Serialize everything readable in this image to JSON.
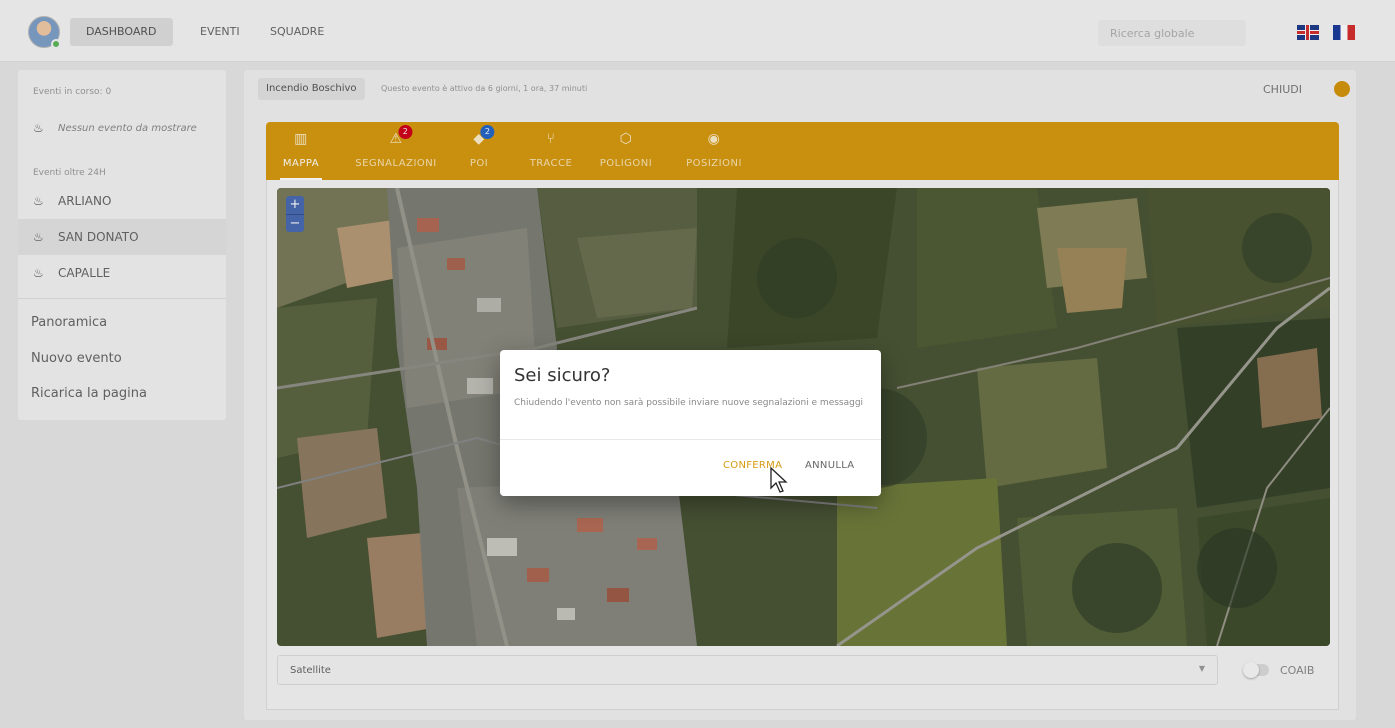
{
  "topbar": {
    "nav": [
      "DASHBOARD",
      "EVENTI",
      "SQUADRE"
    ],
    "active_nav": "DASHBOARD",
    "search_placeholder": "Ricerca globale",
    "languages": [
      "en-flag-icon",
      "fr-flag-icon"
    ]
  },
  "sidebar": {
    "running_label": "Eventi in corso: 0",
    "no_events": "Nessun evento da mostrare",
    "over24_label": "Eventi oltre 24H",
    "events": [
      "ARLIANO",
      "SAN DONATO",
      "CAPALLE"
    ],
    "selected_event": "SAN DONATO",
    "links": [
      "Panoramica",
      "Nuovo evento",
      "Ricarica la pagina"
    ]
  },
  "event": {
    "name": "Incendio Boschivo",
    "status": "Questo evento è attivo da 6 giorni, 1 ora, 37 minuti",
    "close_label": "CHIUDI",
    "status_color": "#d4940c"
  },
  "tabs": [
    {
      "label": "MAPPA",
      "icon": "map-icon",
      "badge": null,
      "active": true
    },
    {
      "label": "SEGNALAZIONI",
      "icon": "warning-icon",
      "badge": "2",
      "active": false
    },
    {
      "label": "POI",
      "icon": "poi-icon",
      "badge": "2",
      "active": false
    },
    {
      "label": "TRACCE",
      "icon": "route-icon",
      "badge": null,
      "active": false
    },
    {
      "label": "POLIGONI",
      "icon": "polygon-icon",
      "badge": null,
      "active": false
    },
    {
      "label": "POSIZIONI",
      "icon": "position-icon",
      "badge": null,
      "active": false
    }
  ],
  "map": {
    "zoom_in": "+",
    "zoom_out": "−",
    "layer": "Satellite",
    "toggle_label": "COAIB",
    "toggle_on": false
  },
  "dialog": {
    "title": "Sei sicuro?",
    "text": "Chiudendo l'evento non sarà possibile inviare nuove segnalazioni e messaggi",
    "confirm": "CONFERMA",
    "cancel": "ANNULLA"
  },
  "colors": {
    "accent": "#d69a12",
    "badge_red": "#d0021b",
    "badge_blue": "#2566c8",
    "zoom_blue": "#4a6ab2"
  }
}
